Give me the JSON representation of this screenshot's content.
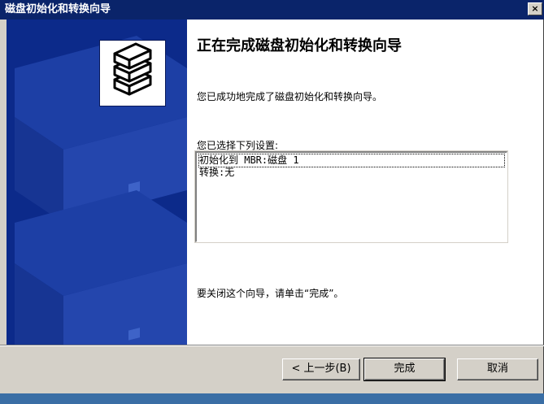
{
  "window": {
    "title": "磁盘初始化和转换向导",
    "close_glyph": "×"
  },
  "main": {
    "heading": "正在完成磁盘初始化和转换向导",
    "description": "您已成功地完成了磁盘初始化和转换向导。",
    "settings_label": "您已选择下列设置:",
    "settings_lines": [
      "初始化到 MBR:磁盘 1",
      "转换:无"
    ],
    "close_hint": "要关闭这个向导，请单击“完成”。"
  },
  "buttons": {
    "back_label": "< 上一步(B)",
    "finish_label": "完成",
    "cancel_label": "取消"
  },
  "colors": {
    "titlebar": "#0a246a",
    "watermark": "#0c2a8a",
    "dialog_face": "#d4d0c8"
  },
  "icons": {
    "wizard_logo": "stacked-disks-icon",
    "watermark_art": "server-stack-watermark"
  }
}
